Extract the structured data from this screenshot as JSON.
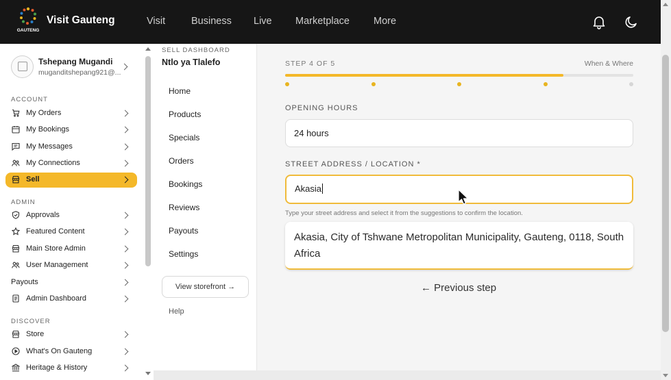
{
  "header": {
    "logo_text": "GAUTENG",
    "brand": "Visit Gauteng",
    "nav": [
      "Visit",
      "Business",
      "Live",
      "Marketplace",
      "More"
    ],
    "icons": [
      "bell-icon",
      "moon-icon"
    ]
  },
  "profile": {
    "name": "Tshepang Mugandi",
    "email": "muganditshepang921@..."
  },
  "sidebar": {
    "sections": {
      "account": "ACCOUNT",
      "admin": "ADMIN",
      "discover": "DISCOVER"
    },
    "account_items": [
      {
        "label": "My Orders",
        "icon": "cart-icon"
      },
      {
        "label": "My Bookings",
        "icon": "calendar-icon"
      },
      {
        "label": "My Messages",
        "icon": "message-icon"
      },
      {
        "label": "My Connections",
        "icon": "people-icon"
      },
      {
        "label": "Sell",
        "icon": "store-icon"
      }
    ],
    "admin_items": [
      {
        "label": "Approvals",
        "icon": "shield-check-icon"
      },
      {
        "label": "Featured Content",
        "icon": "star-icon"
      },
      {
        "label": "Main Store Admin",
        "icon": "store-icon"
      },
      {
        "label": "User Management",
        "icon": "people-icon"
      },
      {
        "label": "Payouts",
        "icon": ""
      },
      {
        "label": "Admin Dashboard",
        "icon": "document-icon"
      }
    ],
    "discover_items": [
      {
        "label": "Store",
        "icon": "store-icon"
      },
      {
        "label": "What's On Gauteng",
        "icon": "play-circle-icon"
      },
      {
        "label": "Heritage & History",
        "icon": "landmark-icon"
      }
    ]
  },
  "sell_dashboard": {
    "kicker": "SELL DASHBOARD",
    "store_name": "Ntlo ya Tlalefo",
    "links": [
      "Home",
      "Products",
      "Specials",
      "Orders",
      "Bookings",
      "Reviews",
      "Payouts",
      "Settings"
    ],
    "storefront_button": "View storefront →",
    "help": "Help"
  },
  "form": {
    "step_label": "STEP 4 OF 5",
    "step_title": "When & Where",
    "progress_fraction": 0.8,
    "opening_hours_label": "OPENING HOURS",
    "opening_hours_value": "24 hours",
    "address_label": "STREET ADDRESS / LOCATION *",
    "address_value": "Akasia",
    "address_hint": "Type your street address and select it from the suggestions to confirm the location.",
    "suggestion": "Akasia, City of Tshwane Metropolitan Municipality, Gauteng, 0118, South Africa",
    "previous_step": "← Previous step"
  },
  "colors": {
    "accent": "#f4b829",
    "topbar": "#161616"
  }
}
